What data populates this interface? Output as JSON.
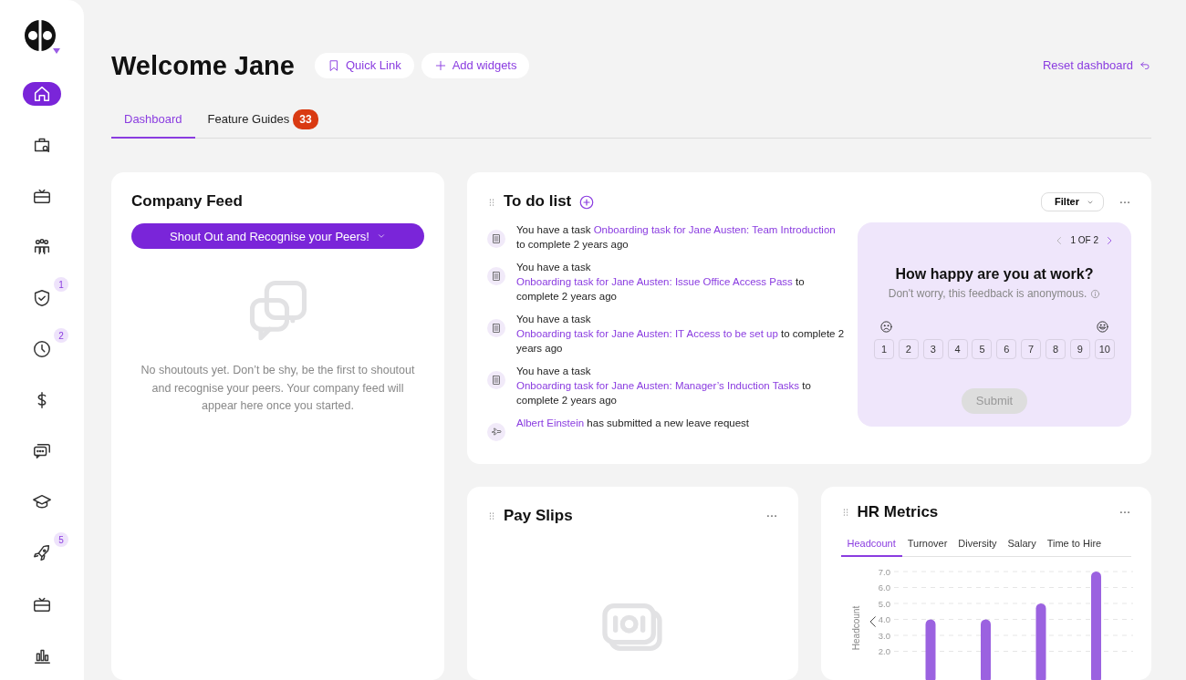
{
  "sidebar": {
    "items": [
      {
        "selected": true
      },
      {
        "selected": false
      },
      {
        "selected": false
      },
      {
        "selected": false
      },
      {
        "selected": false,
        "badge": "1"
      },
      {
        "selected": false,
        "badge": "2"
      },
      {
        "selected": false
      },
      {
        "selected": false
      },
      {
        "selected": false
      },
      {
        "selected": false,
        "badge": "5"
      },
      {
        "selected": false
      },
      {
        "selected": false
      }
    ]
  },
  "header": {
    "title": "Welcome Jane",
    "buttons": [
      "Quick Link",
      "Add widgets"
    ],
    "reset": "Reset dashboard"
  },
  "tabs": [
    {
      "label": "Dashboard",
      "selected": true
    },
    {
      "label": "Feature Guides",
      "selected": false,
      "badge": "33"
    }
  ],
  "company_feed": {
    "title": "Company Feed",
    "button": "Shout Out and Recognise your Peers!",
    "empty_text": "No shoutouts yet. Don’t be shy, be the first to shoutout and recognise your peers. Your company feed will appear here once you started."
  },
  "todo": {
    "title": "To do list",
    "filter": "Filter",
    "items": [
      {
        "kind": "task",
        "before": "You have a task ",
        "link": "Onboarding task for Jane Austen: Team Introduction",
        "after": " to complete 2 years ago"
      },
      {
        "kind": "task",
        "before": "You have a task ",
        "link": "Onboarding task for Jane Austen: Issue Office Access Pass",
        "after": " to complete 2 years ago"
      },
      {
        "kind": "task",
        "before": "You have a task ",
        "link": "Onboarding task for Jane Austen: IT Access to be set up",
        "after": " to complete 2 years ago"
      },
      {
        "kind": "task",
        "before": "You have a task ",
        "link": "Onboarding task for Jane Austen: Manager’s Induction Tasks",
        "after": " to complete 2 years ago"
      },
      {
        "kind": "leave",
        "link": "Albert Einstein",
        "after": " has submitted a new leave request"
      }
    ],
    "survey": {
      "pager": "1 OF 2",
      "question": "How happy are you at work?",
      "note": "Don't worry, this feedback is anonymous.",
      "scale": [
        "1",
        "2",
        "3",
        "4",
        "5",
        "6",
        "7",
        "8",
        "9",
        "10"
      ],
      "submit": "Submit",
      "submit_disabled": true
    }
  },
  "pay_slips": {
    "title": "Pay Slips"
  },
  "hr_metrics": {
    "title": "HR Metrics",
    "tabs": [
      {
        "label": "Headcount",
        "selected": true
      },
      {
        "label": "Turnover",
        "selected": false
      },
      {
        "label": "Diversity",
        "selected": false
      },
      {
        "label": "Salary",
        "selected": false
      },
      {
        "label": "Time to Hire",
        "selected": false
      }
    ],
    "chart_data": {
      "type": "bar",
      "ylabel": "Headcount",
      "grid": true,
      "values": [
        4,
        4,
        5,
        7
      ],
      "ylim": [
        0,
        7
      ],
      "yticks": [
        {
          "value": 2,
          "label": "2.0"
        },
        {
          "value": 3,
          "label": "3.0"
        },
        {
          "value": 4,
          "label": "4.0"
        },
        {
          "value": 5,
          "label": "5.0"
        },
        {
          "value": 6,
          "label": "6.0"
        },
        {
          "value": 7,
          "label": "7.0"
        }
      ]
    }
  }
}
